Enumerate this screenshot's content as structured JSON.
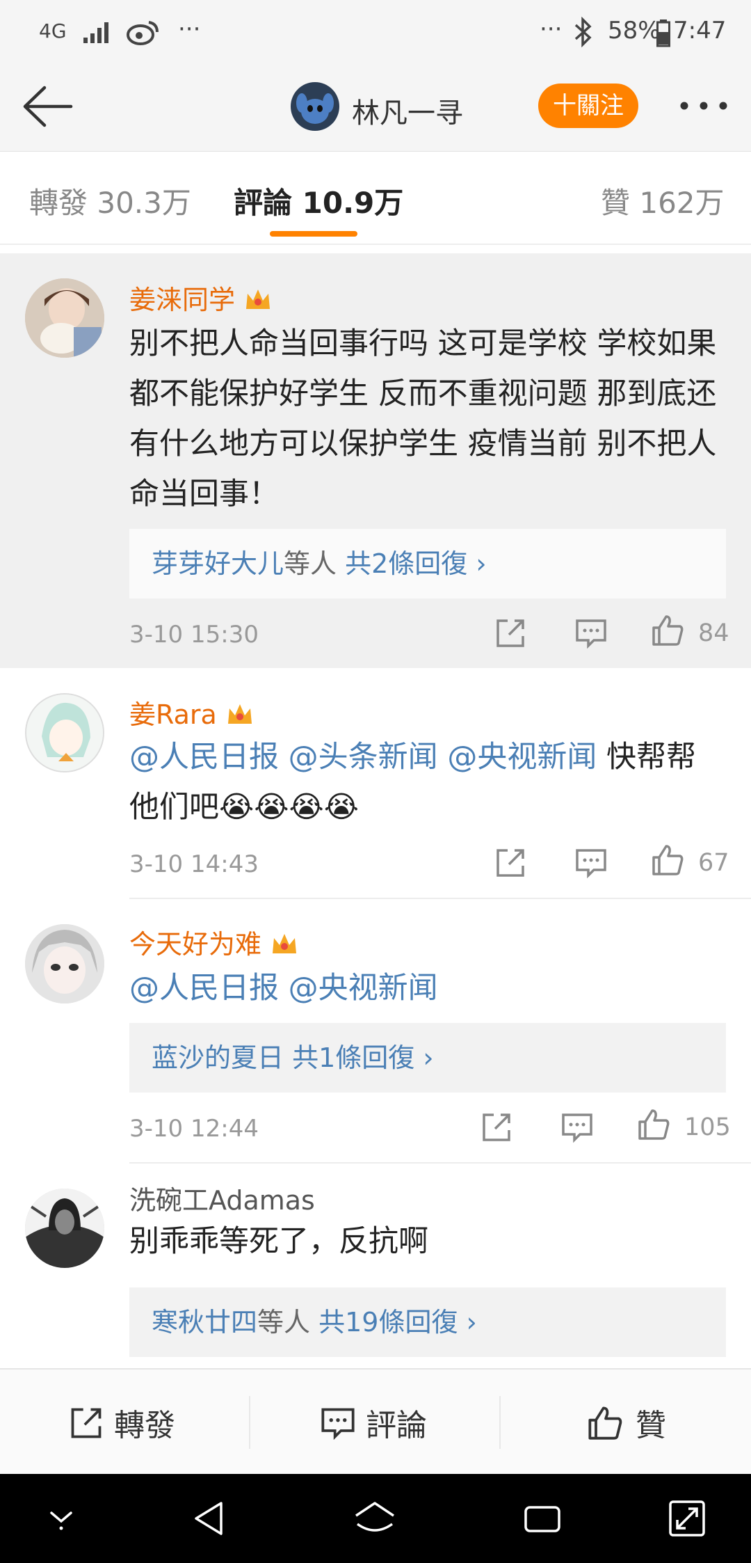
{
  "status_bar": {
    "network": "4G",
    "dots_left": "···",
    "dots_right": "···",
    "battery": "58%",
    "time": "7:47"
  },
  "header": {
    "name": "林凡一寻",
    "follow_label": "十關注",
    "back_icon": "back-arrow-icon",
    "more_icon": "more-dots-icon"
  },
  "tabs": {
    "repost": "轉發 30.3万",
    "comments": "評論 10.9万",
    "likes": "贊 162万"
  },
  "comments": [
    {
      "username": "姜涞同学",
      "text": "别不把人命当回事行吗 这可是学校 学校如果都不能保护好学生 反而不重视问题 那到底还有什么地方可以保护学生 疫情当前 别不把人命当回事！",
      "replies": {
        "names": "芽芽好大儿",
        "suffix": "等人",
        "count": "共2條回復"
      },
      "time": "3-10 15:30",
      "likes": "84"
    },
    {
      "username": "姜Rara",
      "mentions": [
        "@人民日报",
        "@头条新闻",
        "@央视新闻"
      ],
      "text": "快帮帮他们吧",
      "emoji": "😭😭😭😭",
      "time": "3-10 14:43",
      "likes": "67"
    },
    {
      "username": "今天好为难",
      "mentions": [
        "@人民日报",
        "@央视新闻"
      ],
      "replies": {
        "names": "蓝沙的夏日",
        "suffix": "",
        "count": "共1條回復"
      },
      "time": "3-10 12:44",
      "likes": "105"
    },
    {
      "username": "洗碗工Adamas",
      "text": "别乖乖等死了，反抗啊",
      "replies": {
        "names": "寒秋廿四",
        "suffix": "等人",
        "count": "共19條回復"
      }
    }
  ],
  "bottom_bar": {
    "repost": "轉發",
    "comment": "評論",
    "like": "贊"
  },
  "colors": {
    "accent": "#ff8200",
    "username": "#e86b0a",
    "link": "#4a7fb5"
  }
}
